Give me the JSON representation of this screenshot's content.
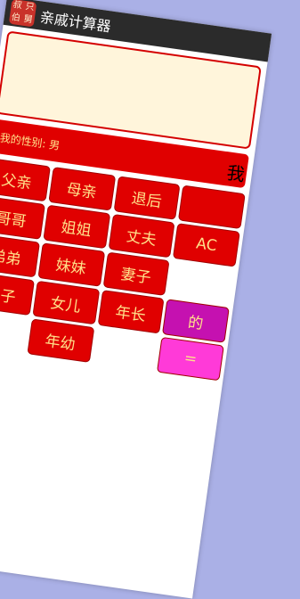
{
  "app": {
    "title": "亲戚计算器",
    "icon_chars": [
      "叔",
      "只",
      "伯",
      "舅"
    ]
  },
  "display": {
    "value": ""
  },
  "info": {
    "gender_label": "我的性别: 男",
    "result_char": "我"
  },
  "keys": [
    {
      "label": "父亲",
      "name": "father-key"
    },
    {
      "label": "母亲",
      "name": "mother-key"
    },
    {
      "label": "退后",
      "name": "backspace-key"
    },
    {
      "label": "",
      "name": "blank-key"
    },
    {
      "label": "哥哥",
      "name": "elder-brother-key"
    },
    {
      "label": "姐姐",
      "name": "elder-sister-key"
    },
    {
      "label": "丈夫",
      "name": "husband-key"
    },
    {
      "label": "AC",
      "name": "clear-key"
    },
    {
      "label": "弟弟",
      "name": "younger-brother-key"
    },
    {
      "label": "妹妹",
      "name": "younger-sister-key"
    },
    {
      "label": "妻子",
      "name": "wife-key"
    },
    {
      "label": "",
      "name": "blank-key-2"
    },
    {
      "label": "儿子",
      "name": "son-key"
    },
    {
      "label": "女儿",
      "name": "daughter-key"
    },
    {
      "label": "年长",
      "name": "older-key"
    },
    {
      "label": "的",
      "name": "of-key"
    },
    {
      "label": "",
      "name": "blank-key-3"
    },
    {
      "label": "年幼",
      "name": "younger-key"
    },
    {
      "label": "",
      "name": "blank-key-4"
    },
    {
      "label": "=",
      "name": "equals-key"
    }
  ],
  "colors": {
    "accent": "#e00000",
    "text": "#ffe08a",
    "display_bg": "#fff5db",
    "of_key": "#c511b0",
    "equals_key": "#ff3ad8"
  }
}
